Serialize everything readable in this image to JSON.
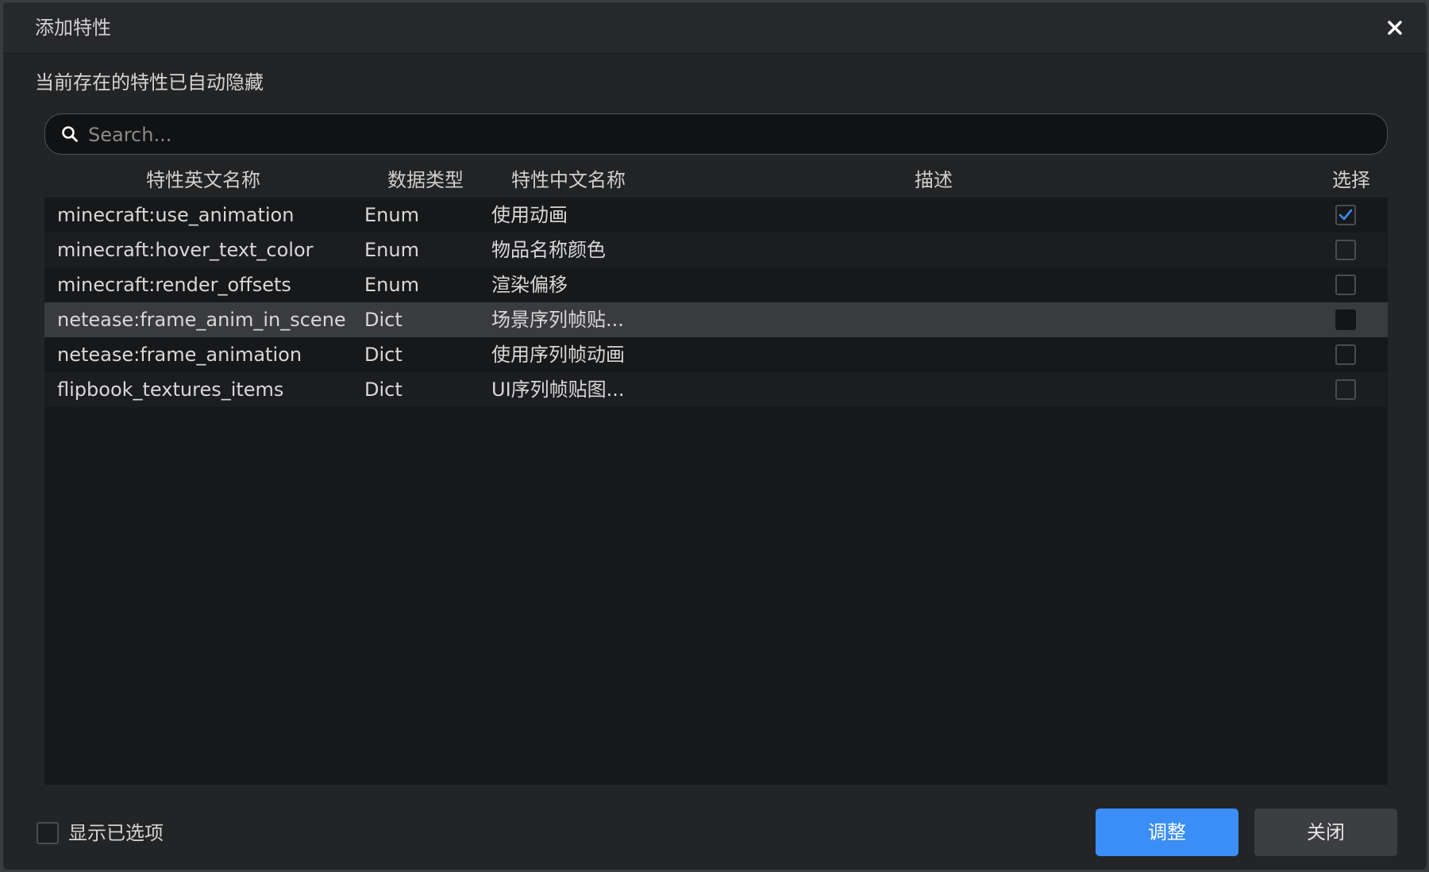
{
  "dialog": {
    "title": "添加特性",
    "notice": "当前存在的特性已自动隐藏"
  },
  "search": {
    "placeholder": "Search..."
  },
  "table": {
    "headers": {
      "english_name": "特性英文名称",
      "data_type": "数据类型",
      "chinese_name": "特性中文名称",
      "description": "描述",
      "select": "选择"
    },
    "rows": [
      {
        "english_name": "minecraft:use_animation",
        "data_type": "Enum",
        "chinese_name": "使用动画",
        "description": "",
        "checked": true
      },
      {
        "english_name": "minecraft:hover_text_color",
        "data_type": "Enum",
        "chinese_name": "物品名称颜色",
        "description": "",
        "checked": false
      },
      {
        "english_name": "minecraft:render_offsets",
        "data_type": "Enum",
        "chinese_name": "渲染偏移",
        "description": "",
        "checked": false
      },
      {
        "english_name": "netease:frame_anim_in_scene",
        "data_type": "Dict",
        "chinese_name": "场景序列帧贴...",
        "description": "",
        "checked": false
      },
      {
        "english_name": "netease:frame_animation",
        "data_type": "Dict",
        "chinese_name": "使用序列帧动画",
        "description": "",
        "checked": false
      },
      {
        "english_name": "flipbook_textures_items",
        "data_type": "Dict",
        "chinese_name": "UI序列帧贴图...",
        "description": "",
        "checked": false
      }
    ],
    "selected_row_index": 3
  },
  "footer": {
    "show_selected_label": "显示已选项",
    "show_selected_checked": false,
    "adjust_label": "调整",
    "close_label": "关闭"
  },
  "colors": {
    "accent": "#3a8ef6",
    "check": "#3a8ef6"
  }
}
